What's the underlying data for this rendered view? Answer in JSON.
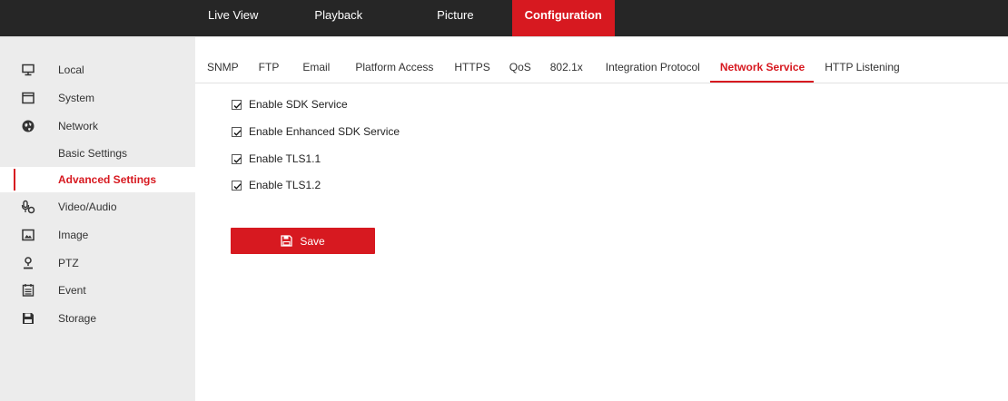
{
  "top_nav": {
    "items": [
      {
        "label": "Live View",
        "active": false
      },
      {
        "label": "Playback",
        "active": false
      },
      {
        "label": "Picture",
        "active": false
      },
      {
        "label": "Configuration",
        "active": true
      }
    ]
  },
  "sidebar": {
    "items": [
      {
        "label": "Local",
        "icon": "monitor-icon"
      },
      {
        "label": "System",
        "icon": "system-window-icon"
      },
      {
        "label": "Network",
        "icon": "globe-icon"
      },
      {
        "label": "Basic Settings",
        "sub": true
      },
      {
        "label": "Advanced Settings",
        "sub": true,
        "active": true
      },
      {
        "label": "Video/Audio",
        "icon": "microphone-camera-icon"
      },
      {
        "label": "Image",
        "icon": "image-icon"
      },
      {
        "label": "PTZ",
        "icon": "ptz-person-icon"
      },
      {
        "label": "Event",
        "icon": "calendar-icon"
      },
      {
        "label": "Storage",
        "icon": "floppy-disk-icon"
      }
    ]
  },
  "tabs": {
    "items": [
      {
        "label": "SNMP"
      },
      {
        "label": "FTP"
      },
      {
        "label": "Email"
      },
      {
        "label": "Platform Access"
      },
      {
        "label": "HTTPS"
      },
      {
        "label": "QoS"
      },
      {
        "label": "802.1x"
      },
      {
        "label": "Integration Protocol"
      },
      {
        "label": "Network Service",
        "active": true
      },
      {
        "label": "HTTP Listening"
      }
    ]
  },
  "options": [
    {
      "label": "Enable SDK Service",
      "checked": true
    },
    {
      "label": "Enable Enhanced SDK Service",
      "checked": true
    },
    {
      "label": "Enable TLS1.1",
      "checked": true
    },
    {
      "label": "Enable TLS1.2",
      "checked": true
    }
  ],
  "save_button": {
    "label": "Save",
    "icon": "save-icon"
  },
  "colors": {
    "accent": "#d71920",
    "topbar": "#262626",
    "sidebar": "#ececec"
  }
}
